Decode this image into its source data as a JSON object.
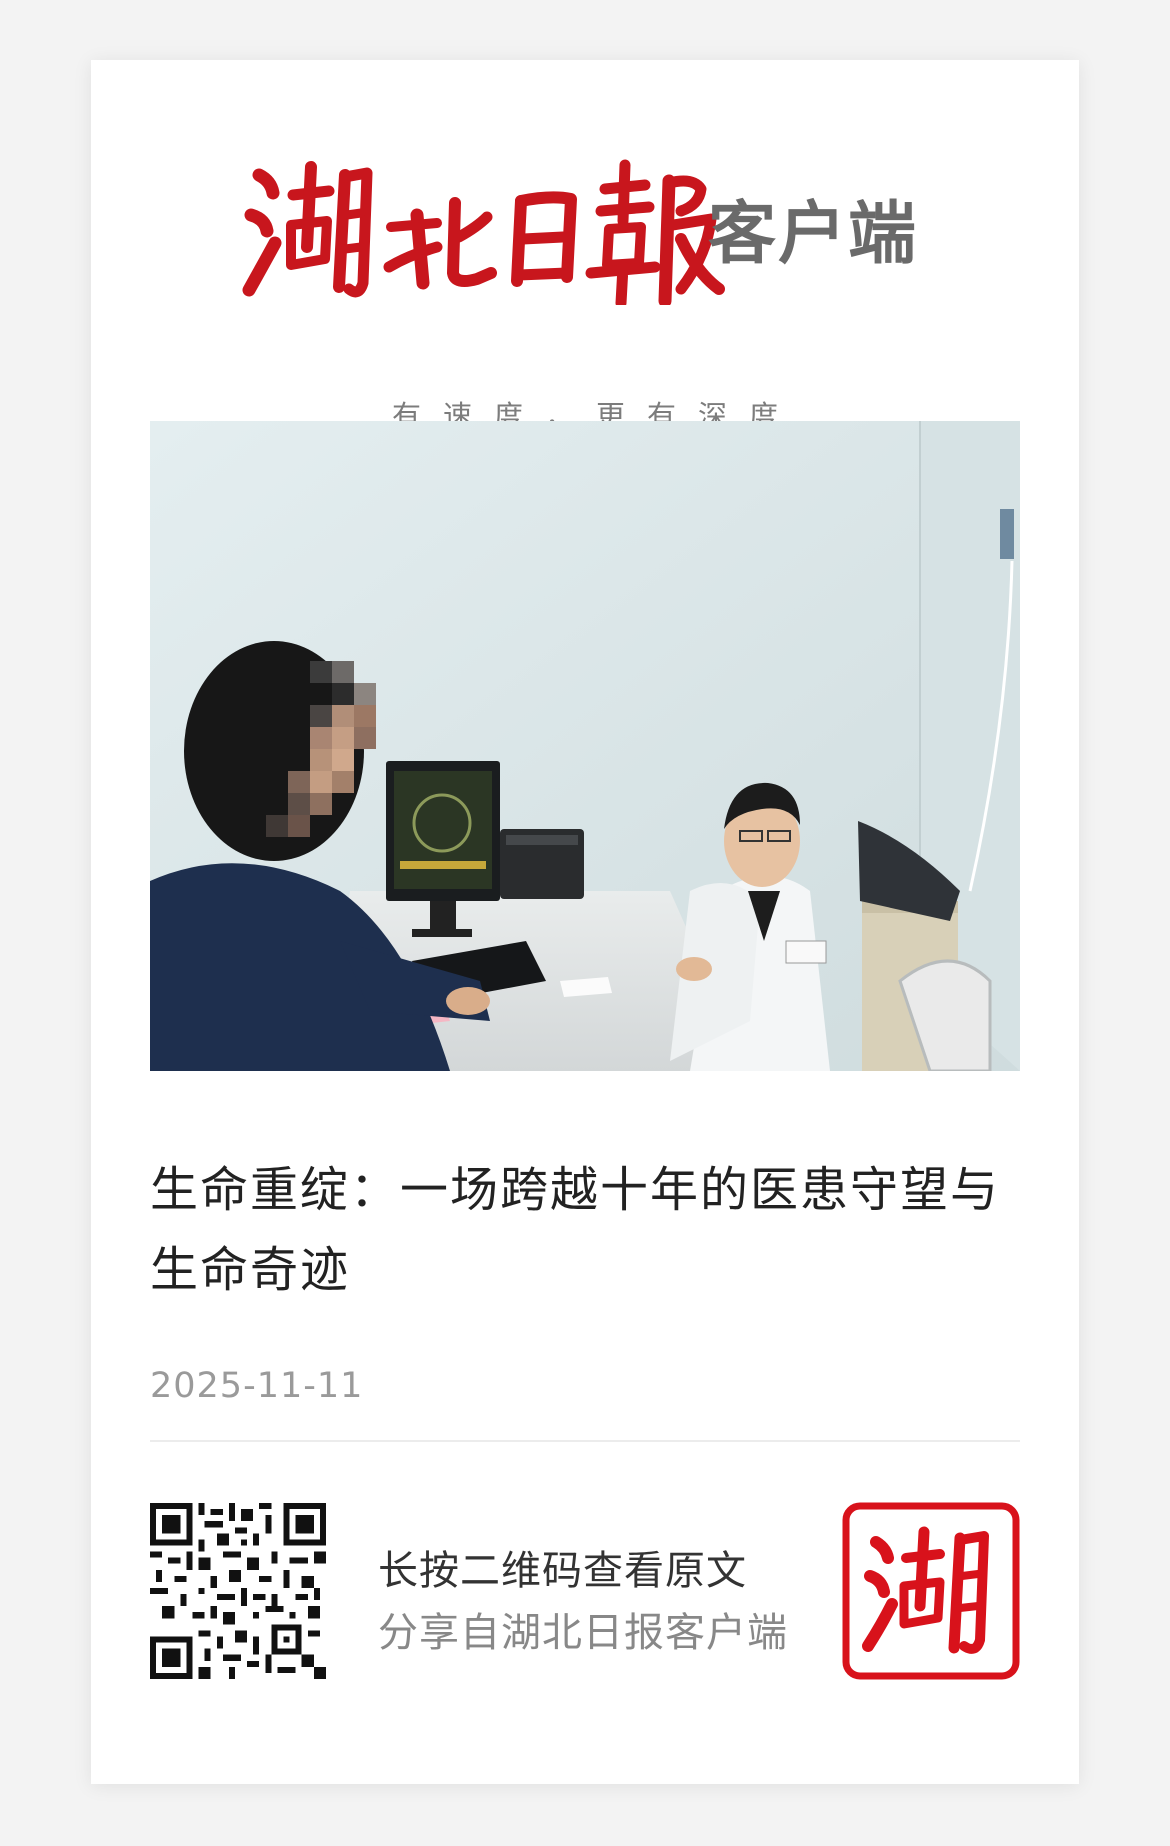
{
  "masthead": {
    "calligraphy_title": "湖北日報",
    "suffix": "客户端",
    "slogan": "有速度，更有深度",
    "brand_color": "#c8161d"
  },
  "article": {
    "title": "生命重绽：一场跨越十年的医患守望与生命奇迹",
    "date": "2025-11-11"
  },
  "share": {
    "line1": "长按二维码查看原文",
    "line2": "分享自湖北日报客户端",
    "seal_char": "湖"
  }
}
